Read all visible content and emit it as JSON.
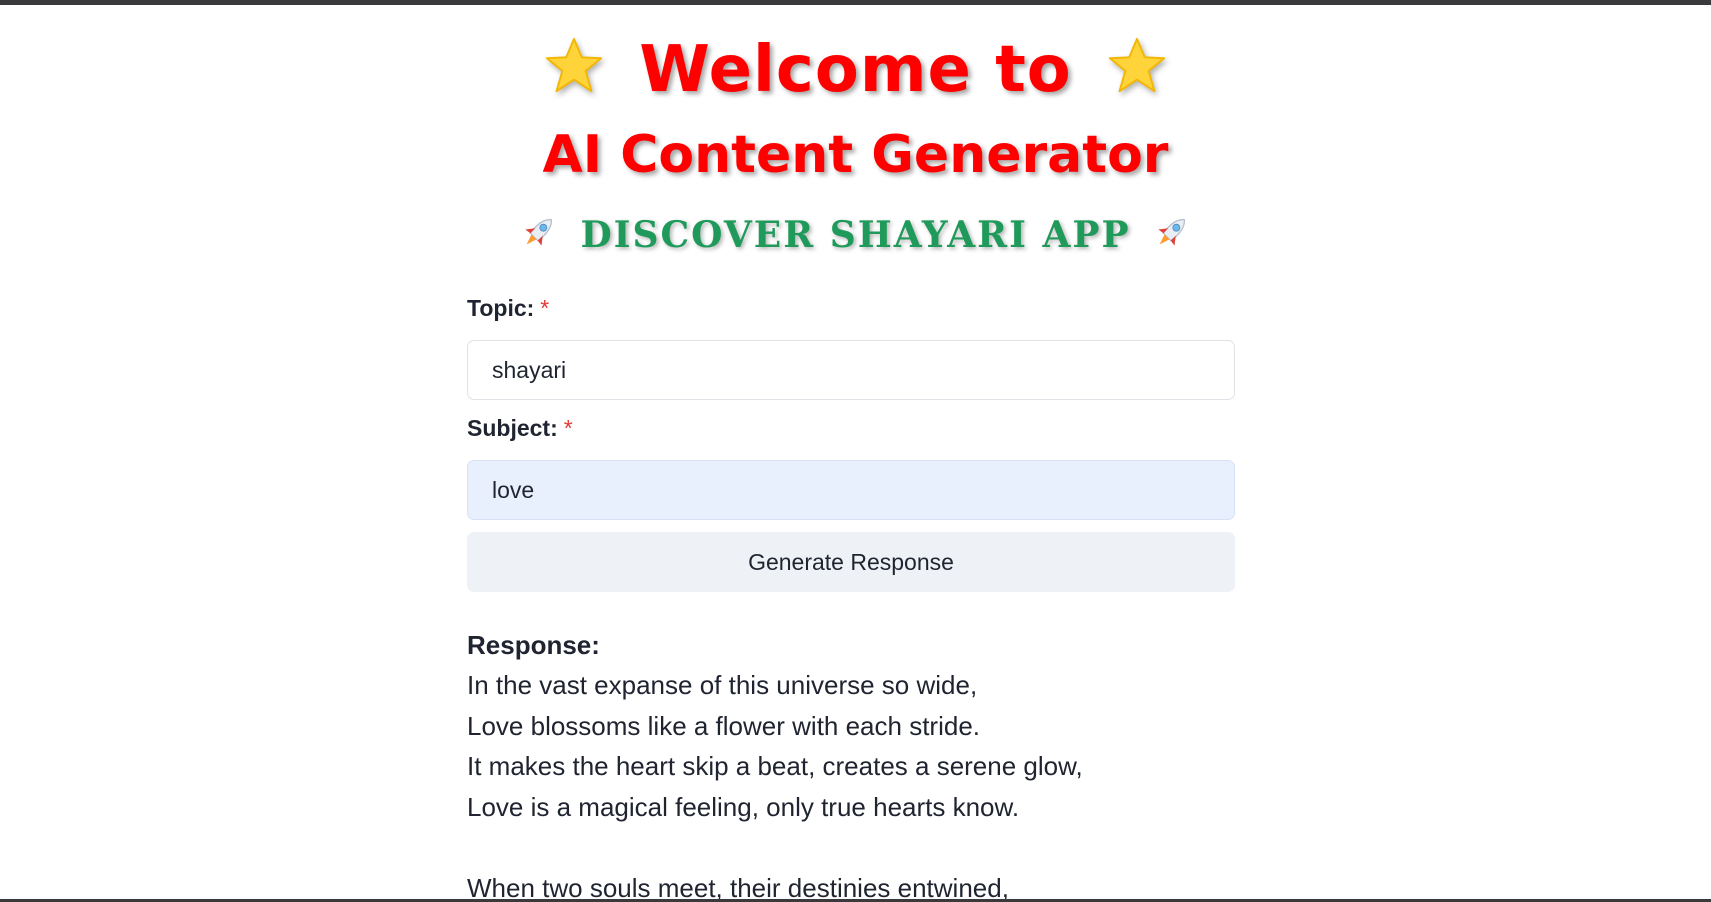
{
  "hero": {
    "title_line1": "Welcome to",
    "title_line2": "AI Content Generator",
    "title_line3": "DISCOVER SHAYARI APP",
    "decor_left": "star-icon",
    "decor_right": "star-icon",
    "sub_decor": "rocket-icon",
    "title_color": "#ff0000",
    "subtitle_color": "#1f9a5b"
  },
  "form": {
    "topic_label": "Topic:",
    "topic_required": "*",
    "topic_value": "shayari",
    "subject_label": "Subject:",
    "subject_required": "*",
    "subject_value": "love",
    "generate_button": "Generate Response"
  },
  "response": {
    "heading": "Response:",
    "lines": [
      "In the vast expanse of this universe so wide,",
      "Love blossoms like a flower with each stride.",
      "It makes the heart skip a beat, creates a serene glow,",
      "Love is a magical feeling, only true hearts know.",
      "",
      "When two souls meet, their destinies entwined,"
    ]
  }
}
